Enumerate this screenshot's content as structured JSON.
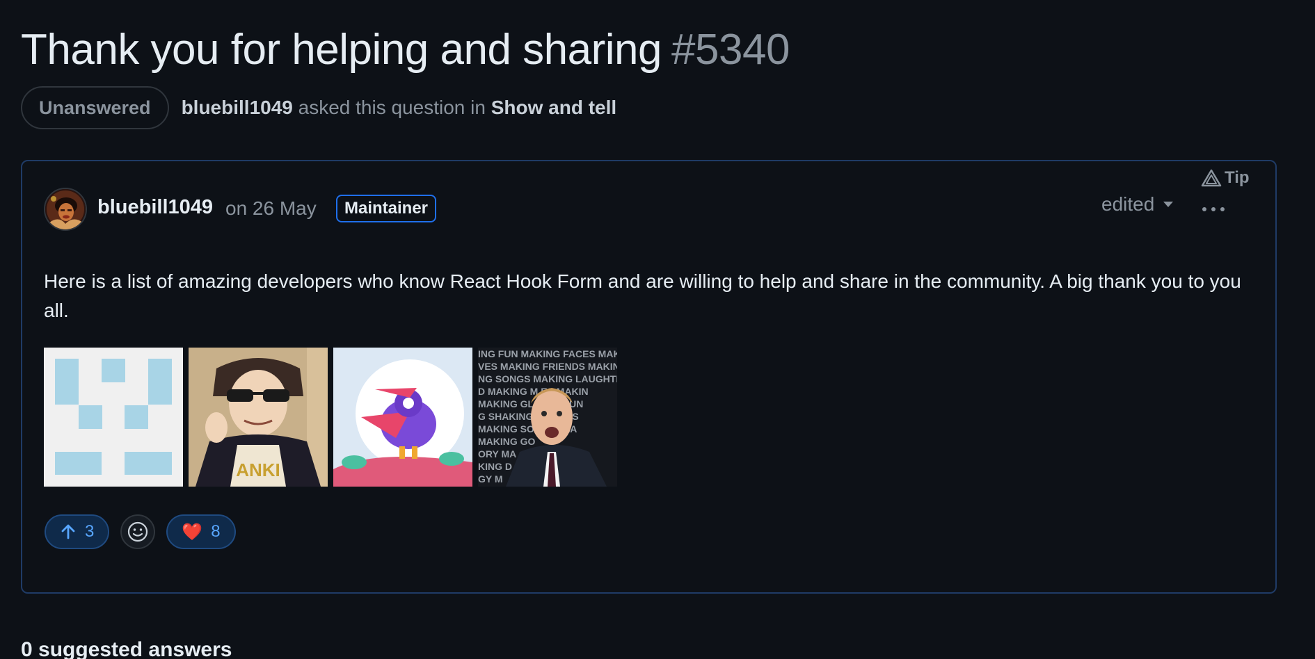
{
  "discussion": {
    "title": "Thank you for helping and sharing",
    "number": "#5340",
    "state": "Unanswered",
    "asker": "bluebill1049",
    "asked_text": "asked this question in",
    "category": "Show and tell"
  },
  "post": {
    "author": "bluebill1049",
    "date": "on 26 May",
    "role_badge": "Maintainer",
    "tip_label": "Tip",
    "edited_label": "edited",
    "body": "Here is a list of amazing developers who know React Hook Form and are willing to help and share in the community. A big thank you to you all.",
    "images": [
      {
        "name": "identicon-avatar"
      },
      {
        "name": "anime-sunglasses-avatar"
      },
      {
        "name": "purple-bird-avatar"
      },
      {
        "name": "making-faces-avatar"
      }
    ],
    "reactions": {
      "upvote_count": "3",
      "heart_emoji": "❤️",
      "heart_count": "8"
    }
  },
  "answers": {
    "heading": "0 suggested answers"
  },
  "colors": {
    "background": "#0d1117",
    "card_border": "#1f3b66",
    "accent": "#58a6ff",
    "muted": "#8b949e"
  }
}
